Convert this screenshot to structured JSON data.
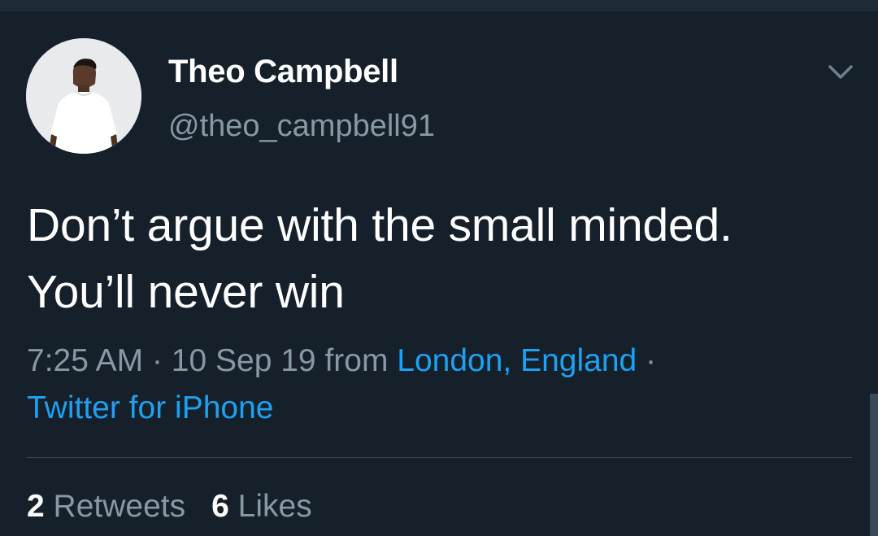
{
  "tweet": {
    "author": {
      "display_name": "Theo Campbell",
      "handle": "@theo_campbell91"
    },
    "text_lines": [
      "Don’t argue with the small minded.",
      "You’ll never win"
    ],
    "meta": {
      "time": "7:25 AM",
      "date": "10 Sep 19",
      "from_label": "from",
      "location": "London, England",
      "separator": "·",
      "source": "Twitter for iPhone"
    },
    "stats": {
      "retweets_count": "2",
      "retweets_label": "Retweets",
      "likes_count": "6",
      "likes_label": "Likes"
    }
  },
  "icons": {
    "more": "chevron-down-icon"
  },
  "colors": {
    "background": "#15202b",
    "primary_text": "#ffffff",
    "secondary_text": "#8899a6",
    "link": "#1da1f2",
    "divider": "#38444d"
  }
}
